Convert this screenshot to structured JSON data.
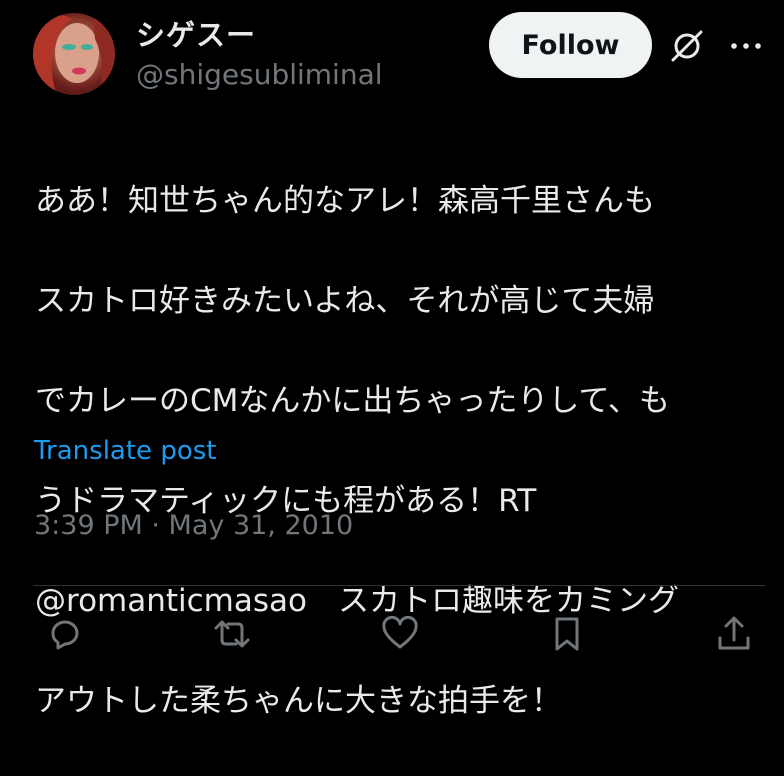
{
  "author": {
    "display_name": "シゲスー",
    "handle": "@shigesubliminal",
    "avatar_icon": "profile-avatar"
  },
  "header": {
    "follow_label": "Follow",
    "grok_icon": "grok-icon",
    "more_icon": "more-options-icon"
  },
  "post": {
    "lines": [
      "ああ！知世ちゃん的なアレ！森高千里さんも",
      "スカトロ好きみたいよね、それが高じて夫婦",
      "でカレーのCMなんかに出ちゃったりして、も",
      "うドラマティックにも程がある！RT",
      "@romanticmasao　スカトロ趣味をカミング",
      "アウトした柔ちゃんに大きな拍手を！"
    ],
    "translate_label": "Translate post",
    "timestamp": "3:39 PM · May 31, 2010"
  },
  "actions": [
    {
      "name": "reply-icon"
    },
    {
      "name": "repost-icon"
    },
    {
      "name": "like-icon"
    },
    {
      "name": "bookmark-icon"
    },
    {
      "name": "share-icon"
    }
  ],
  "colors": {
    "background": "#000000",
    "text": "#e7e9ea",
    "muted": "#71767b",
    "link": "#1d9bf0",
    "divider": "#2f3336",
    "follow_bg": "#eff3f4"
  }
}
